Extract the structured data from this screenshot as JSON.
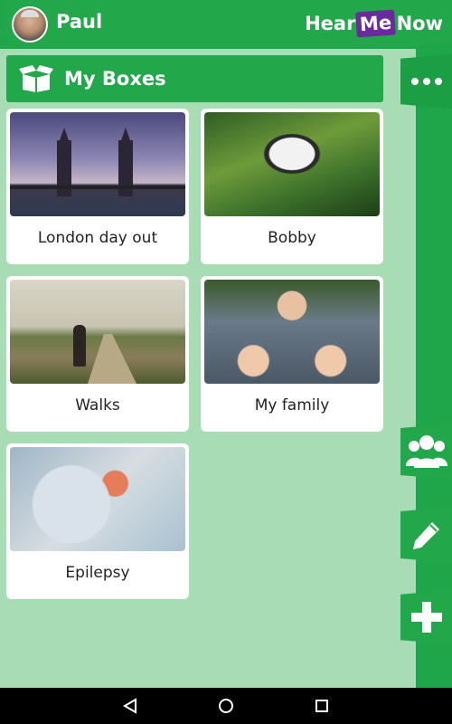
{
  "header": {
    "user_name": "Paul",
    "brand_part1": "Hear",
    "brand_part2": "Me",
    "brand_part3": "Now"
  },
  "section": {
    "title": "My Boxes",
    "icon": "box-icon"
  },
  "boxes": [
    {
      "label": "London day out"
    },
    {
      "label": "Bobby"
    },
    {
      "label": "Walks"
    },
    {
      "label": "My family"
    },
    {
      "label": "Epilepsy"
    }
  ],
  "side_actions": [
    {
      "icon": "more-icon"
    },
    {
      "icon": "group-icon"
    },
    {
      "icon": "pencil-icon"
    },
    {
      "icon": "plus-icon"
    }
  ],
  "colors": {
    "primary": "#22a84b",
    "background": "#a8dcb5",
    "brand_accent": "#6a2a9c"
  }
}
